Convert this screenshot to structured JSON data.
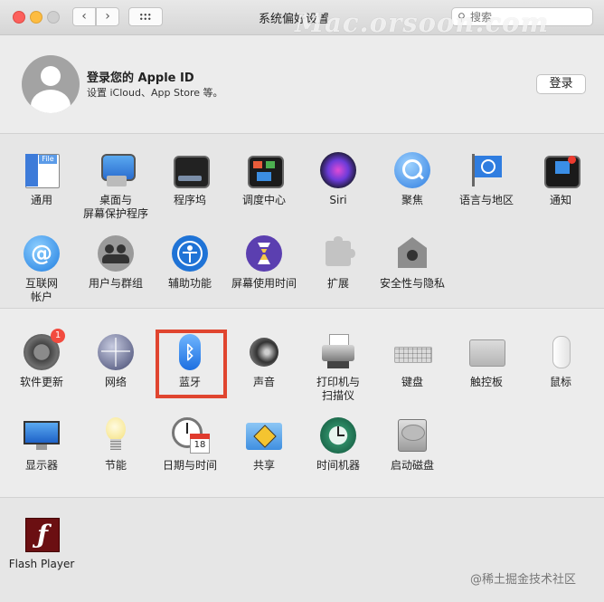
{
  "window": {
    "title": "系统偏好设置"
  },
  "toolbar": {
    "back": "‹",
    "forward": "›"
  },
  "search": {
    "placeholder": "搜索"
  },
  "watermark": "Mac.orsoon.com",
  "apple_id": {
    "title": "登录您的 Apple ID",
    "subtitle": "设置 iCloud、App Store 等。",
    "login_label": "登录"
  },
  "section1": {
    "row1": [
      {
        "label": "通用",
        "icon": "general-icon"
      },
      {
        "label": "桌面与\n屏幕保护程序",
        "icon": "desktop-icon"
      },
      {
        "label": "程序坞",
        "icon": "dock-icon"
      },
      {
        "label": "调度中心",
        "icon": "mission-control-icon"
      },
      {
        "label": "Siri",
        "icon": "siri-icon"
      },
      {
        "label": "聚焦",
        "icon": "spotlight-icon"
      },
      {
        "label": "语言与地区",
        "icon": "language-icon"
      },
      {
        "label": "通知",
        "icon": "notifications-icon"
      }
    ],
    "row2": [
      {
        "label": "互联网\n帐户",
        "icon": "internet-accounts-icon"
      },
      {
        "label": "用户与群组",
        "icon": "users-icon"
      },
      {
        "label": "辅助功能",
        "icon": "accessibility-icon"
      },
      {
        "label": "屏幕使用时间",
        "icon": "screen-time-icon"
      },
      {
        "label": "扩展",
        "icon": "extensions-icon"
      },
      {
        "label": "安全性与隐私",
        "icon": "security-icon"
      }
    ]
  },
  "section2": {
    "row1": [
      {
        "label": "软件更新",
        "icon": "software-update-icon",
        "badge": "1"
      },
      {
        "label": "网络",
        "icon": "network-icon"
      },
      {
        "label": "蓝牙",
        "icon": "bluetooth-icon"
      },
      {
        "label": "声音",
        "icon": "sound-icon"
      },
      {
        "label": "打印机与\n扫描仪",
        "icon": "printer-icon"
      },
      {
        "label": "键盘",
        "icon": "keyboard-icon"
      },
      {
        "label": "触控板",
        "icon": "trackpad-icon"
      },
      {
        "label": "鼠标",
        "icon": "mouse-icon"
      }
    ],
    "row2": [
      {
        "label": "显示器",
        "icon": "display-icon"
      },
      {
        "label": "节能",
        "icon": "energy-icon"
      },
      {
        "label": "日期与时间",
        "icon": "date-time-icon"
      },
      {
        "label": "共享",
        "icon": "sharing-icon"
      },
      {
        "label": "时间机器",
        "icon": "time-machine-icon"
      },
      {
        "label": "启动磁盘",
        "icon": "startup-disk-icon"
      }
    ]
  },
  "section3": {
    "items": [
      {
        "label": "Flash Player",
        "icon": "flash-icon"
      }
    ]
  },
  "attribution": "@稀土掘金技术社区"
}
